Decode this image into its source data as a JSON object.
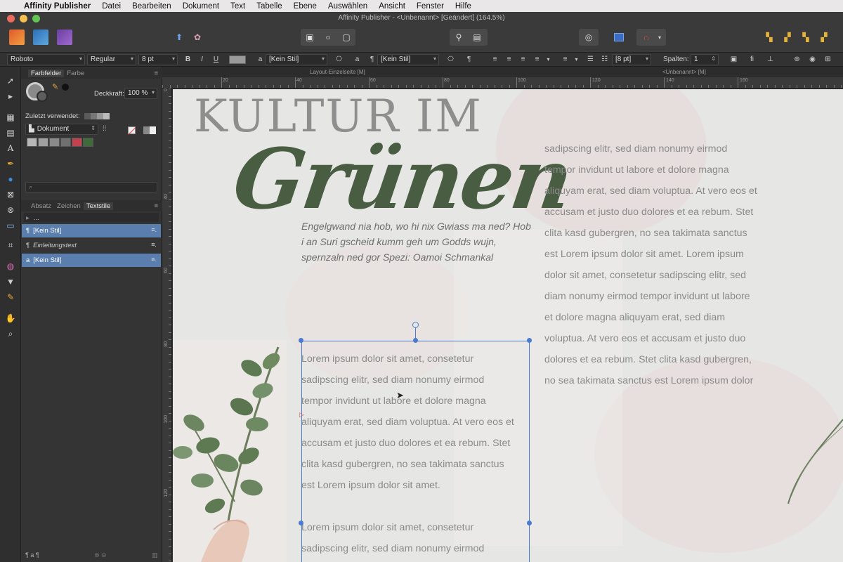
{
  "menubar": {
    "app_name": "Affinity Publisher",
    "items": [
      "Datei",
      "Bearbeiten",
      "Dokument",
      "Text",
      "Tabelle",
      "Ebene",
      "Auswählen",
      "Ansicht",
      "Fenster",
      "Hilfe"
    ]
  },
  "window": {
    "title": "Affinity Publisher - <Unbenannt> [Geändert] (164.5%)"
  },
  "context_toolbar": {
    "font_family": "Roboto",
    "font_style": "Regular",
    "font_size": "8 pt",
    "bold": "B",
    "italic": "I",
    "underline": "U",
    "char_style": "[Kein Stil]",
    "para_style": "[Kein Stil]",
    "leading": "[8 pt]",
    "columns_label": "Spalten:",
    "columns_value": "1"
  },
  "panel": {
    "tabs_top": [
      "Farbfelder",
      "Farbe"
    ],
    "opacity_label": "Deckkraft:",
    "opacity_value": "100 %",
    "recent_label": "Zuletzt verwendet:",
    "palette_select": "Dokument",
    "swatch_colors": [
      "#b8b8b8",
      "#a0a0a0",
      "#8a8a8a",
      "#707070",
      "#c0434e",
      "#3f6a3c"
    ],
    "tabs_text": [
      "Absatz",
      "Zeichen",
      "Textstile"
    ],
    "styles": [
      {
        "label": "...",
        "selected": false
      },
      {
        "label": "[Kein Stil]",
        "selected": true
      },
      {
        "label": "Einleitungstext",
        "selected": false
      },
      {
        "label": "[Kein Stil]",
        "selected": true
      }
    ]
  },
  "doc_tabs": {
    "left": "Layout-Einzelseite [M]",
    "right": "<Unbenannt> [M]"
  },
  "ruler": {
    "h_labels": [
      "20",
      "40",
      "60",
      "80",
      "100",
      "120",
      "140",
      "160"
    ],
    "v_labels": [
      "0",
      "40",
      "60",
      "80",
      "100",
      "120",
      "140"
    ]
  },
  "document": {
    "headline": "KULTUR IM",
    "script_title": "Grünen",
    "intro": "Engelgwand nia hob, wo hi nix Gwiass ma ned? Hob i an Suri gscheid kumm geh um Godds wujn, spernzaln ned gor Spezi: Oamoi Schmankal",
    "right_column_lines": [
      "sadipscing elitr, sed diam nonumy eirmod",
      "tempor invidunt ut labore et dolore magna",
      "aliquyam erat, sed diam voluptua. At vero eos et",
      "accusam et justo duo dolores et ea rebum. Stet",
      "clita kasd gubergren, no sea takimata sanctus",
      "est Lorem ipsum dolor sit amet. Lorem ipsum",
      "dolor sit amet, consetetur sadipscing elitr, sed",
      "diam nonumy eirmod tempor invidunt ut labore",
      "et dolore magna aliquyam erat, sed diam",
      "voluptua. At vero eos et accusam et justo duo",
      "dolores et ea rebum. Stet clita kasd gubergren,",
      "no sea takimata sanctus est Lorem ipsum dolor"
    ],
    "frame_lines": [
      "Lorem ipsum dolor sit amet, consetetur",
      "sadipscing elitr, sed diam nonumy eirmod",
      "tempor invidunt ut labore et dolore magna",
      "aliquyam erat, sed diam voluptua. At vero eos et",
      "accusam et justo duo dolores et ea rebum. Stet",
      "clita kasd gubergren, no sea takimata sanctus",
      "est Lorem ipsum dolor sit amet.",
      "",
      "Lorem ipsum dolor sit amet, consetetur",
      "sadipscing elitr, sed diam nonumy eirmod"
    ]
  }
}
